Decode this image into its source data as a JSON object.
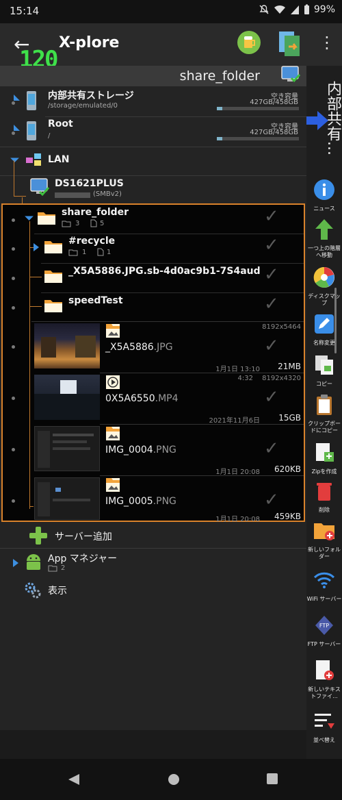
{
  "status_bar": {
    "time": "15:14",
    "battery": "99%"
  },
  "fps_counter": "120",
  "app_bar": {
    "title": "X-plore"
  },
  "pane": {
    "current_folder": "share_folder",
    "side_title": "内部共有..."
  },
  "tree": {
    "storage": [
      {
        "name": "内部共有ストレージ",
        "path": "/storage/emulated/0",
        "free_label": "空き容量",
        "capacity": "427GB/458GB",
        "used_fraction": 0.07
      },
      {
        "name": "Root",
        "path": "/",
        "free_label": "空き容量",
        "capacity": "427GB/458GB",
        "used_fraction": 0.07
      }
    ],
    "lan": {
      "name": "LAN"
    },
    "server": {
      "name": "DS1621PLUS",
      "protocol": "(SMBv2)"
    },
    "share_folder": {
      "name": "share_folder",
      "folders": "3",
      "files": "5"
    },
    "subfolders": [
      {
        "name": "#recycle",
        "folders": "1",
        "files": "1"
      },
      {
        "name": "_X5A5886.JPG.sb-4d0ac9b1-7S4aud"
      },
      {
        "name": "speedTest"
      }
    ],
    "files": [
      {
        "name": "_X5A5886",
        "ext": ".JPG",
        "resolution": "8192x5464",
        "duration": "",
        "date": "1月1日 13:10",
        "size": "21MB"
      },
      {
        "name": "0X5A6550",
        "ext": ".MP4",
        "resolution": "8192x4320",
        "duration": "4:32",
        "date": "2021年11月6日",
        "size": "15GB"
      },
      {
        "name": "IMG_0004",
        "ext": ".PNG",
        "resolution": "",
        "duration": "",
        "date": "1月1日 20:08",
        "size": "620KB"
      },
      {
        "name": "IMG_0005",
        "ext": ".PNG",
        "resolution": "",
        "duration": "",
        "date": "1月1日 20:08",
        "size": "459KB"
      }
    ],
    "add_server": "サーバー追加",
    "app_manager": {
      "name": "App マネジャー",
      "count": "2"
    },
    "display": "表示"
  },
  "side_buttons": [
    {
      "label": "ニュース",
      "icon": "info-icon"
    },
    {
      "label": "一つ上の階層へ移動",
      "icon": "up-arrow-icon"
    },
    {
      "label": "ディスクマップ",
      "icon": "disk-map-icon"
    },
    {
      "label": "名称変更",
      "icon": "rename-icon"
    },
    {
      "label": "コピー",
      "icon": "copy-icon"
    },
    {
      "label": "クリップボードにコピー",
      "icon": "clipboard-icon"
    },
    {
      "label": "Zipを作成",
      "icon": "zip-icon"
    },
    {
      "label": "削除",
      "icon": "trash-icon"
    },
    {
      "label": "新しいフォルダー",
      "icon": "new-folder-icon"
    },
    {
      "label": "WiFi サーバー",
      "icon": "wifi-icon"
    },
    {
      "label": "FTP サーバー",
      "icon": "ftp-icon"
    },
    {
      "label": "新しいテキストファイ...",
      "icon": "new-text-file-icon"
    },
    {
      "label": "並べ替え",
      "icon": "sort-icon"
    }
  ]
}
